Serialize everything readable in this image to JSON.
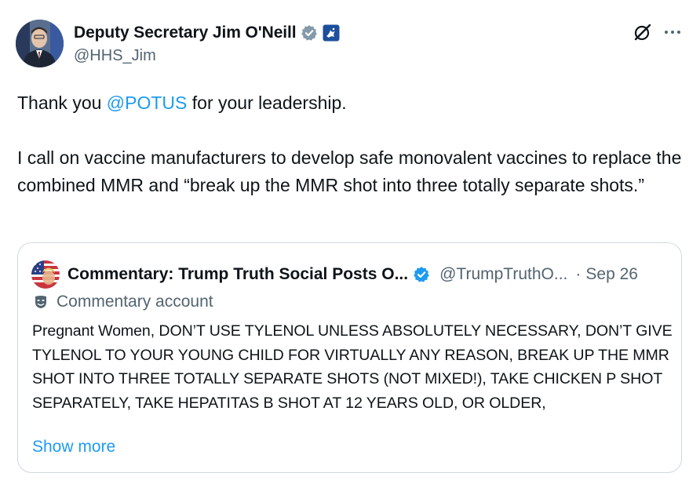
{
  "author": {
    "display_name": "Deputy Secretary Jim O'Neill",
    "handle": "@HHS_Jim",
    "verified_icon": "verified-badge-icon",
    "affiliation_icon": "hhs-eagle-icon"
  },
  "actions": {
    "grok_icon": "grok-icon",
    "more_icon": "more-icon"
  },
  "tweet": {
    "line1_pre": "Thank you ",
    "line1_mention": "@POTUS",
    "line1_post": " for your leadership.",
    "paragraph2": "I call on vaccine manufacturers to develop safe monovalent vaccines to replace the combined MMR and “break up the MMR shot into three totally separate shots.”"
  },
  "quote": {
    "display_name": "Commentary: Trump Truth Social Posts O...",
    "handle": "@TrumpTruthO...",
    "separator": "·",
    "date": "Sep 26",
    "label": "Commentary account",
    "body": "Pregnant Women, DON’T USE TYLENOL UNLESS ABSOLUTELY NECESSARY, DON’T GIVE TYLENOL TO YOUR YOUNG CHILD FOR VIRTUALLY ANY REASON, BREAK UP THE MMR SHOT INTO THREE TOTALLY SEPARATE SHOTS (NOT MIXED!), TAKE CHICKEN P SHOT SEPARATELY, TAKE HEPATITAS B SHOT AT 12 YEARS OLD, OR OLDER,",
    "show_more": "Show more"
  },
  "colors": {
    "link": "#1d9bf0",
    "secondary": "#536471",
    "text": "#0f1419",
    "border": "#cfd9de"
  }
}
